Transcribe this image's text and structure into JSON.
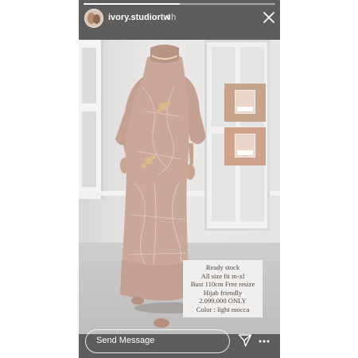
{
  "story": {
    "username": "ivory.studiortw",
    "time": "4h",
    "progress": 0.5
  },
  "caption": {
    "lines": [
      "Ready stock",
      "All size fit m-xl",
      "Bust 110cm Free resize",
      "Hijab friendly",
      "2.099.000 ONLY",
      "Color : light mocca"
    ]
  },
  "footer": {
    "send_placeholder": "Send Message"
  },
  "icons": {
    "close": "close-icon",
    "share": "paper-plane-icon",
    "more": "more-dots-icon"
  },
  "colors": {
    "swatch_1": "#c6a38a",
    "swatch_2": "#cfa28c",
    "dress": "#c9a89b"
  }
}
